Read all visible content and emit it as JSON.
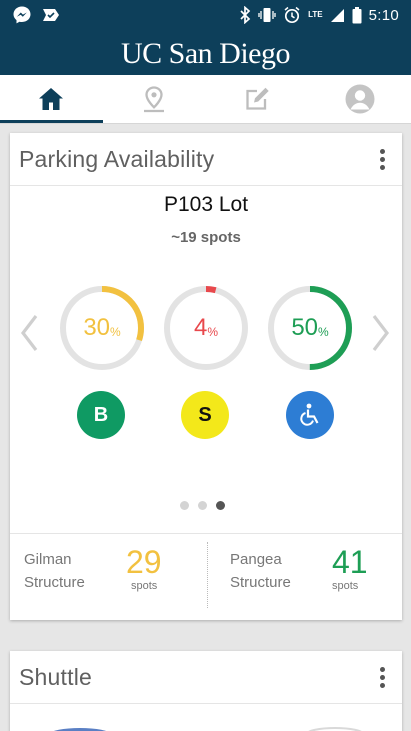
{
  "status_bar": {
    "time": "5:10",
    "network": "LTE"
  },
  "header": {
    "title": "UC San Diego"
  },
  "tabs": [
    {
      "name": "home",
      "icon": "home-icon"
    },
    {
      "name": "map",
      "icon": "map-pin-icon"
    },
    {
      "name": "feedback",
      "icon": "edit-icon"
    },
    {
      "name": "profile",
      "icon": "profile-icon"
    }
  ],
  "parking": {
    "title": "Parking Availability",
    "lot_name": "P103 Lot",
    "lot_spots": "~19 spots",
    "gauges": [
      {
        "value": "30",
        "unit": "%",
        "fraction": 0.3,
        "color": "#f2c140"
      },
      {
        "value": "4",
        "unit": "%",
        "fraction": 0.04,
        "color": "#e8484c"
      },
      {
        "value": "50",
        "unit": "%",
        "fraction": 0.5,
        "color": "#1e9e55"
      }
    ],
    "permits": [
      {
        "label": "B",
        "color": "#0f9a63",
        "text_color": "#ffffff"
      },
      {
        "label": "S",
        "color": "#f3e81a",
        "text_color": "#111111"
      },
      {
        "label": "accessible",
        "color": "#2d7dd4",
        "text_color": "#ffffff"
      }
    ],
    "pager": {
      "count": 3,
      "active": 3
    },
    "structures": [
      {
        "name_line1": "Gilman",
        "name_line2": "Structure",
        "count": "29",
        "unit": "spots",
        "color": "#f2c140"
      },
      {
        "name_line1": "Pangea",
        "name_line2": "Structure",
        "count": "41",
        "unit": "spots",
        "color": "#1e9e55"
      }
    ]
  },
  "shuttle": {
    "title": "Shuttle"
  },
  "colors": {
    "brand": "#0d3f5a",
    "tab_inactive": "#bdbdbd"
  }
}
